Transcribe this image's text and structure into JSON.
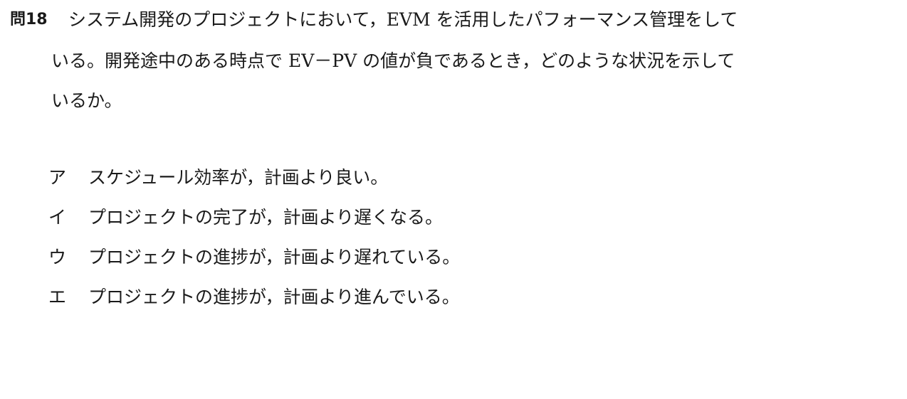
{
  "question": {
    "number": "問18",
    "lines": [
      "システム開発のプロジェクトにおいて，EVM を活用したパフォーマンス管理をして",
      "いる。開発途中のある時点で EV－PV の値が負であるとき，どのような状況を示して",
      "いるか。"
    ]
  },
  "choices": [
    {
      "letter": "ア",
      "text": "スケジュール効率が，計画より良い。"
    },
    {
      "letter": "イ",
      "text": "プロジェクトの完了が，計画より遅くなる。"
    },
    {
      "letter": "ウ",
      "text": "プロジェクトの進捗が，計画より遅れている。"
    },
    {
      "letter": "エ",
      "text": "プロジェクトの進捗が，計画より進んでいる。"
    }
  ]
}
